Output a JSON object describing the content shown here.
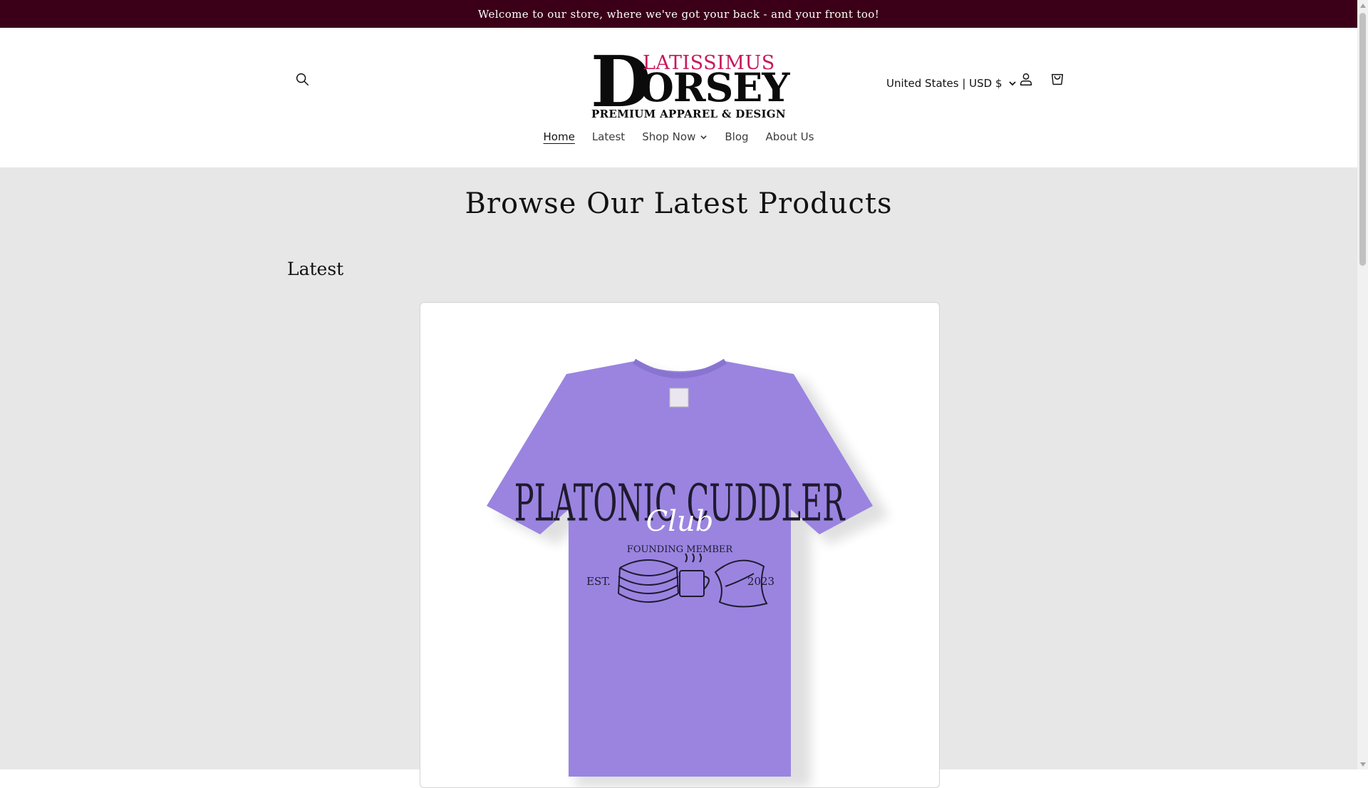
{
  "announcement": {
    "text": "Welcome to our store, where we've got your back - and your front too!"
  },
  "header": {
    "logo": {
      "top_word": "LATISSIMUS",
      "big_letter": "D",
      "rest_word": "ORSEY",
      "tagline": "PREMIUM APPAREL & DESIGN"
    },
    "country_selector": {
      "label": "United States | USD $"
    },
    "icons": {
      "search": "search-icon",
      "account": "account-icon",
      "cart": "cart-icon"
    }
  },
  "nav": {
    "items": [
      {
        "label": "Home"
      },
      {
        "label": "Latest"
      },
      {
        "label": "Shop Now"
      },
      {
        "label": "Blog"
      },
      {
        "label": "About Us"
      }
    ]
  },
  "main": {
    "title": "Browse Our Latest Products",
    "section_title": "Latest",
    "product": {
      "image": {
        "shirt_color": "#9a84e0",
        "print_line1": "PLATONIC CUDDLER",
        "print_script": "Club",
        "print_line2": "FOUNDING MEMBER",
        "est_left": "EST.",
        "est_right": "2023"
      }
    }
  },
  "colors": {
    "announcement_bg": "#3b0018",
    "logo_accent": "#c8185b",
    "page_bg": "#e7e7e7"
  }
}
